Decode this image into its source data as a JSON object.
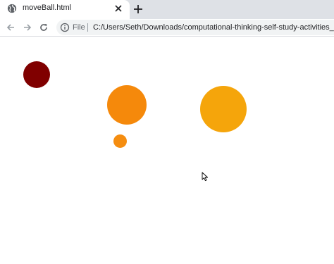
{
  "tab": {
    "title": "moveBall.html",
    "favicon": "globe-icon",
    "close_icon": "close-icon"
  },
  "toolbar": {
    "new_tab_icon": "plus-icon",
    "back_icon": "arrow-left-icon",
    "forward_icon": "arrow-right-icon",
    "reload_icon": "reload-icon",
    "info_icon": "info-icon",
    "scheme_label": "File",
    "url": "C:/Users/Seth/Downloads/computational-thinking-self-study-activities_starte"
  },
  "canvas": {
    "balls": [
      {
        "color": "#800000"
      },
      {
        "color": "#f5890b"
      },
      {
        "color": "#f5a50b"
      },
      {
        "color": "#f58d10"
      }
    ],
    "cursor_icon": "mouse-pointer-icon"
  },
  "colors": {
    "tabstrip": "#dee1e6",
    "omnibox": "#f1f3f4"
  }
}
